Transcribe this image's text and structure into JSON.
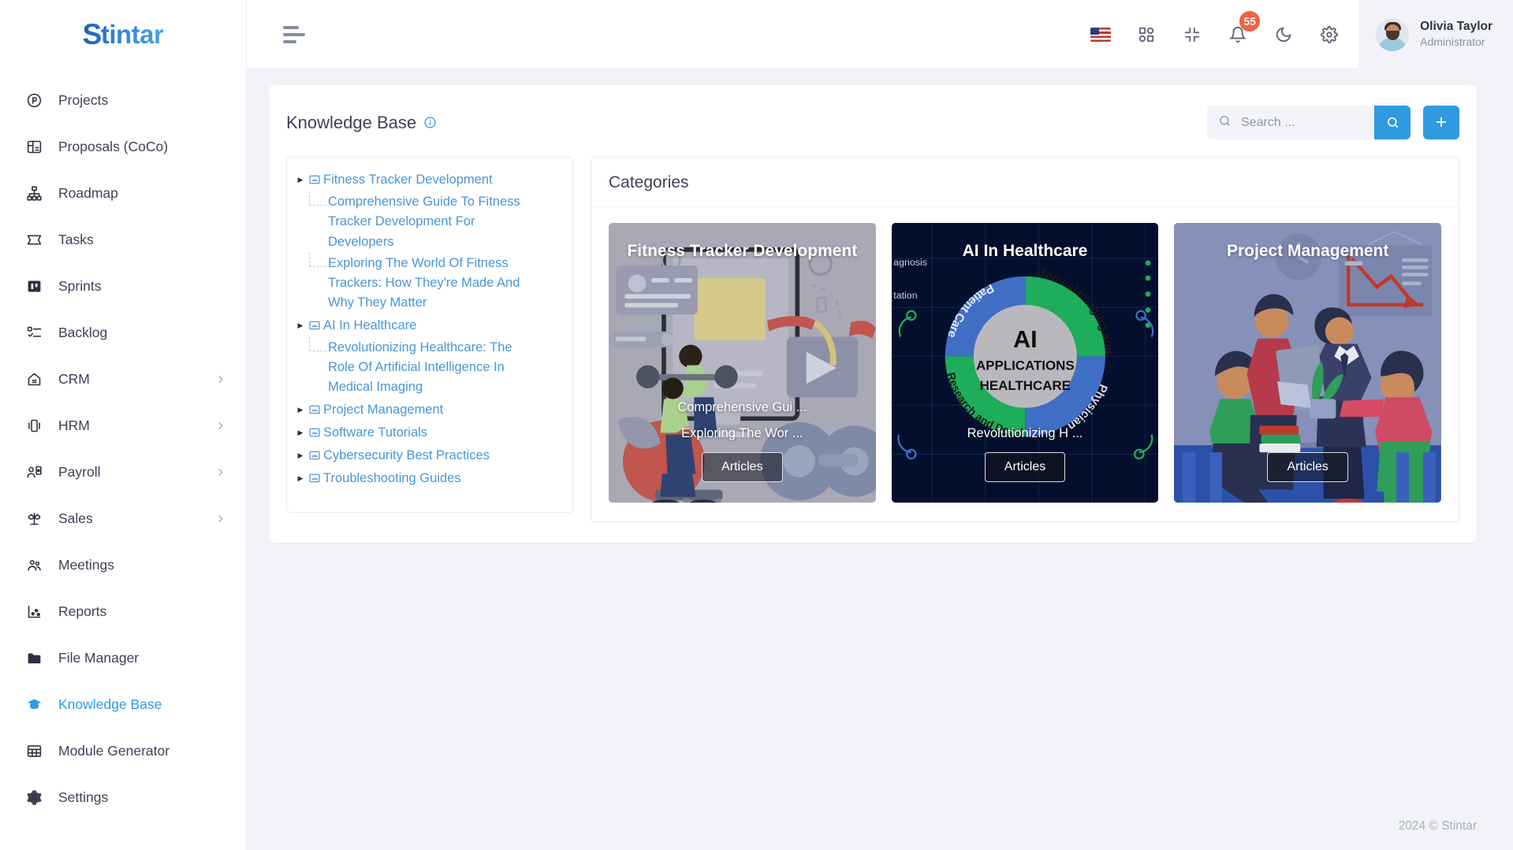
{
  "brand": {
    "name": "Stintar",
    "mark": "S",
    "rest": "tintar"
  },
  "sidebar": {
    "items": [
      {
        "label": "Projects",
        "icon": "projects-icon",
        "caret": false,
        "active": false
      },
      {
        "label": "Proposals (CoCo)",
        "icon": "proposals-icon",
        "caret": false,
        "active": false
      },
      {
        "label": "Roadmap",
        "icon": "roadmap-icon",
        "caret": false,
        "active": false
      },
      {
        "label": "Tasks",
        "icon": "tasks-icon",
        "caret": false,
        "active": false
      },
      {
        "label": "Sprints",
        "icon": "sprints-icon",
        "caret": false,
        "active": false
      },
      {
        "label": "Backlog",
        "icon": "backlog-icon",
        "caret": false,
        "active": false
      },
      {
        "label": "CRM",
        "icon": "crm-icon",
        "caret": true,
        "active": false
      },
      {
        "label": "HRM",
        "icon": "hrm-icon",
        "caret": true,
        "active": false
      },
      {
        "label": "Payroll",
        "icon": "payroll-icon",
        "caret": true,
        "active": false
      },
      {
        "label": "Sales",
        "icon": "sales-icon",
        "caret": true,
        "active": false
      },
      {
        "label": "Meetings",
        "icon": "meetings-icon",
        "caret": false,
        "active": false
      },
      {
        "label": "Reports",
        "icon": "reports-icon",
        "caret": false,
        "active": false
      },
      {
        "label": "File Manager",
        "icon": "file-manager-icon",
        "caret": false,
        "active": false
      },
      {
        "label": "Knowledge Base",
        "icon": "knowledge-base-icon",
        "caret": false,
        "active": true
      },
      {
        "label": "Module Generator",
        "icon": "module-generator-icon",
        "caret": false,
        "active": false
      },
      {
        "label": "Settings",
        "icon": "settings-icon",
        "caret": false,
        "active": false
      }
    ]
  },
  "topbar": {
    "menu_icon": "hamburger-icon",
    "language_icon": "us-flag-icon",
    "apps_icon": "apps-grid-icon",
    "fullscreen_icon": "collapse-screen-icon",
    "notifications_icon": "bell-icon",
    "notifications_count": "55",
    "dark_mode_icon": "moon-icon",
    "settings_icon": "gear-icon",
    "user": {
      "name": "Olivia Taylor",
      "role": "Administrator",
      "avatar": "user-avatar"
    }
  },
  "page": {
    "title": "Knowledge Base",
    "info_icon": "info-circle-icon",
    "search": {
      "placeholder": "Search ...",
      "value": "",
      "icon": "search-icon"
    },
    "search_button_icon": "search-icon",
    "add_button_label": "+"
  },
  "tree": {
    "nodes": [
      {
        "label": "Fitness Tracker Development",
        "children": [
          "Comprehensive Guide To Fitness Tracker Development For Developers",
          "Exploring The World Of Fitness Trackers: How They're Made And Why They Matter"
        ]
      },
      {
        "label": "AI In Healthcare",
        "children": [
          "Revolutionizing Healthcare: The Role Of Artificial Intelligence In Medical Imaging"
        ]
      },
      {
        "label": "Project Management",
        "children": []
      },
      {
        "label": "Software Tutorials",
        "children": []
      },
      {
        "label": "Cybersecurity Best Practices",
        "children": []
      },
      {
        "label": "Troubleshooting Guides",
        "children": []
      }
    ]
  },
  "categories": {
    "heading": "Categories",
    "cards": [
      {
        "title": "Fitness Tracker Development",
        "links": [
          "Comprehensive Gui ...",
          "Exploring The Wor ..."
        ],
        "button": "Articles",
        "bg": "#a9a8b5"
      },
      {
        "title": "AI In Healthcare",
        "links": [
          "Revolutionizing H ..."
        ],
        "button": "Articles",
        "bg": "#030f2c",
        "diagram": {
          "center": [
            "AI",
            "APPLICATIONS",
            "HEALTHCARE"
          ],
          "segments": [
            "Patient Care",
            "Medical Imaging and Diagnostics",
            "Physician",
            "Research and Development"
          ],
          "edge_text": [
            "agnosis",
            "tation"
          ],
          "colors": {
            "blue": "#3f6fc4",
            "green": "#1ead5a",
            "center": "#b9b9bd"
          }
        }
      },
      {
        "title": "Project Management",
        "links": [],
        "button": "Articles",
        "bg": "#8690b8"
      }
    ]
  },
  "footer": {
    "text": "2024 © Stintar"
  }
}
